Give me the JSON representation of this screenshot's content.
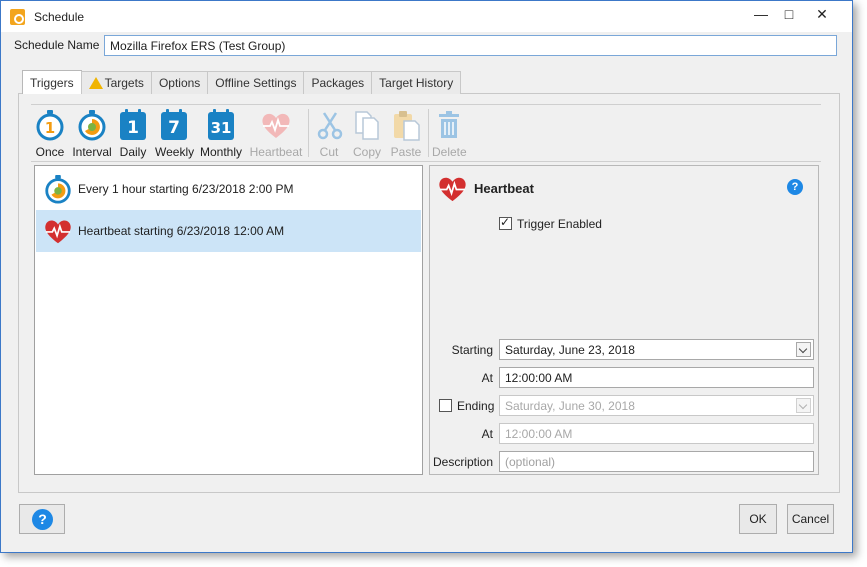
{
  "window": {
    "title": "Schedule"
  },
  "schedule_name": {
    "label": "Schedule Name",
    "value": "Mozilla Firefox ERS (Test Group)"
  },
  "tabs": [
    {
      "label": "Triggers",
      "active": true
    },
    {
      "label": "Targets",
      "warning": true
    },
    {
      "label": "Options"
    },
    {
      "label": "Offline Settings"
    },
    {
      "label": "Packages"
    },
    {
      "label": "Target History"
    }
  ],
  "toolbar": {
    "once": "Once",
    "interval": "Interval",
    "daily": "Daily",
    "weekly": "Weekly",
    "monthly": "Monthly",
    "heartbeat": "Heartbeat",
    "cut": "Cut",
    "copy": "Copy",
    "paste": "Paste",
    "delete": "Delete",
    "daily_num": "1",
    "weekly_num": "7",
    "monthly_num": "31"
  },
  "triggers": [
    {
      "text": "Every 1 hour starting 6/23/2018 2:00 PM",
      "icon": "interval-icon"
    },
    {
      "text": "Heartbeat starting 6/23/2018 12:00 AM",
      "icon": "heartbeat-icon",
      "selected": true
    }
  ],
  "detail": {
    "title": "Heartbeat",
    "trigger_enabled_label": "Trigger Enabled",
    "trigger_enabled": true,
    "starting_label": "Starting",
    "starting_value": "Saturday, June 23, 2018",
    "start_at_label": "At",
    "start_at_value": "12:00:00 AM",
    "ending_label": "Ending",
    "ending_checked": false,
    "ending_value": "Saturday, June 30, 2018",
    "end_at_label": "At",
    "end_at_value": "12:00:00 AM",
    "description_label": "Description",
    "description_placeholder": "(optional)",
    "help": "?"
  },
  "buttons": {
    "help": "?",
    "ok": "OK",
    "cancel": "Cancel"
  },
  "colors": {
    "accent": "#1a82c4",
    "heart": "#d32f2f",
    "selection": "#cce4f7",
    "warning": "#f0b400"
  }
}
